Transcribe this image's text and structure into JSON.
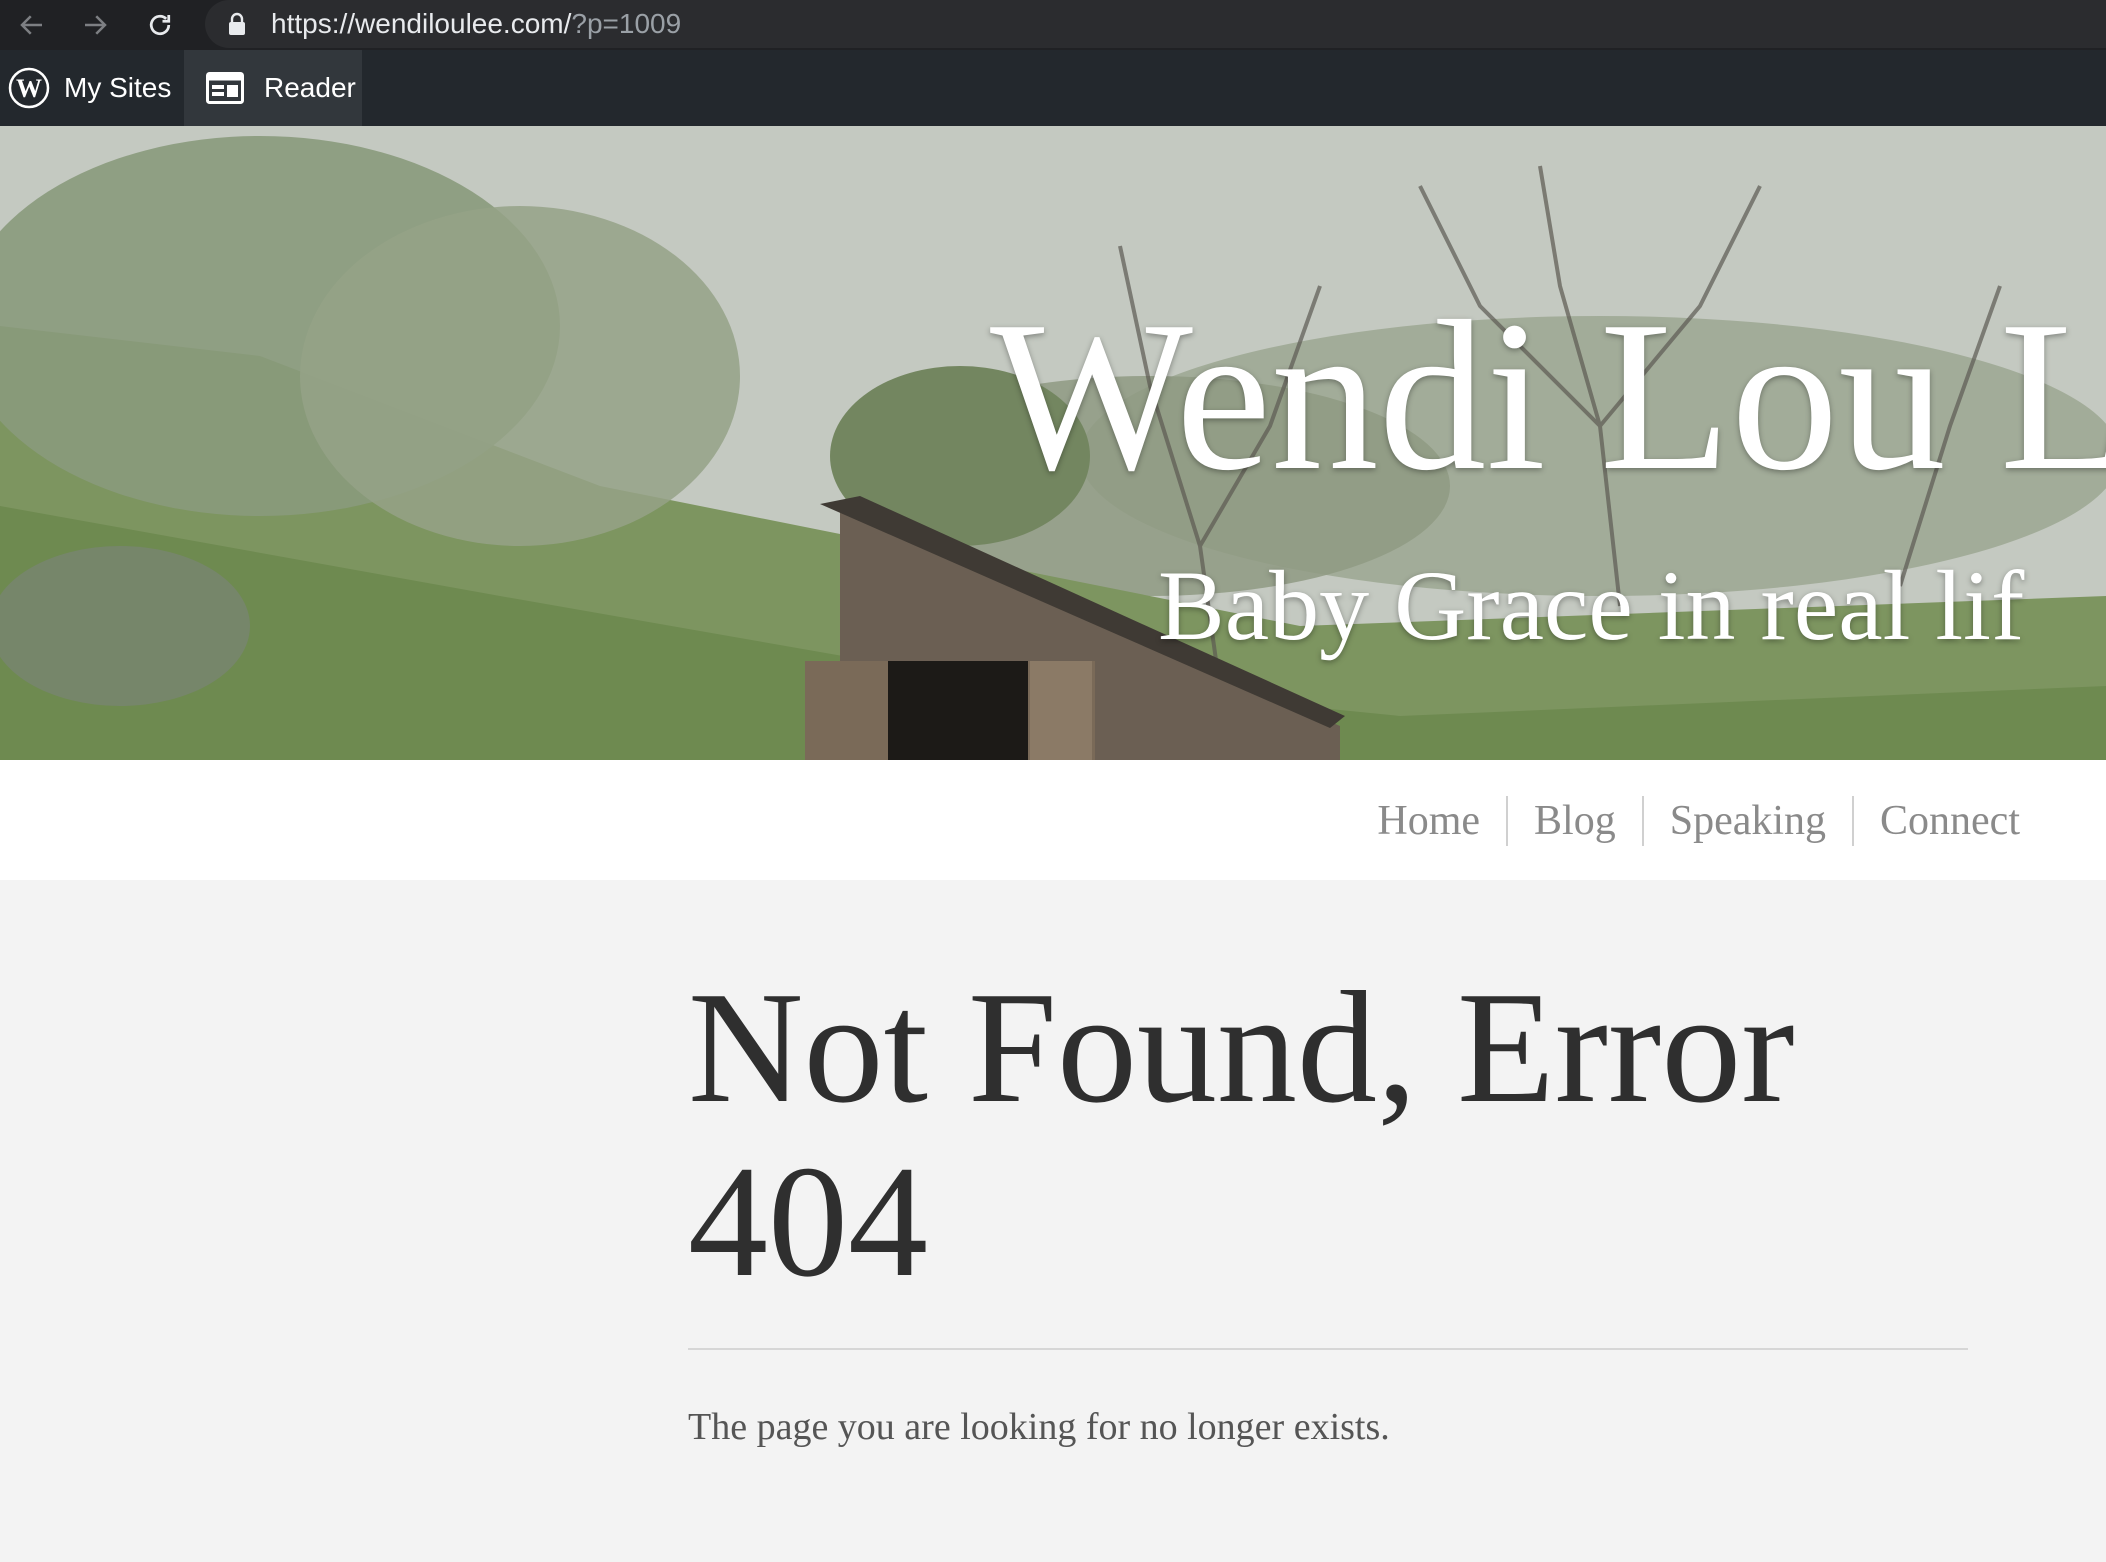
{
  "browser": {
    "url_host": "https://wendiloulee.com/",
    "url_path": "?p=1009",
    "icons": [
      "back-icon",
      "forward-icon",
      "reload-icon",
      "lock-icon"
    ]
  },
  "admin_bar": {
    "my_sites_label": "My Sites",
    "reader_label": "Reader"
  },
  "header": {
    "site_title": "Wendi Lou L",
    "tagline": "Baby Grace in real lif"
  },
  "menu": {
    "items": [
      {
        "label": "Home"
      },
      {
        "label": "Blog"
      },
      {
        "label": "Speaking"
      },
      {
        "label": "Connect"
      }
    ]
  },
  "content": {
    "title": "Not Found, Error 404",
    "message": "The page you are looking for no longer exists."
  },
  "colors": {
    "browser_bar": "#202124",
    "admin_bar": "#23282d",
    "page_background": "#f3f3f3",
    "menu_text": "#8a8a8a",
    "title_text": "#2f2f2f"
  }
}
